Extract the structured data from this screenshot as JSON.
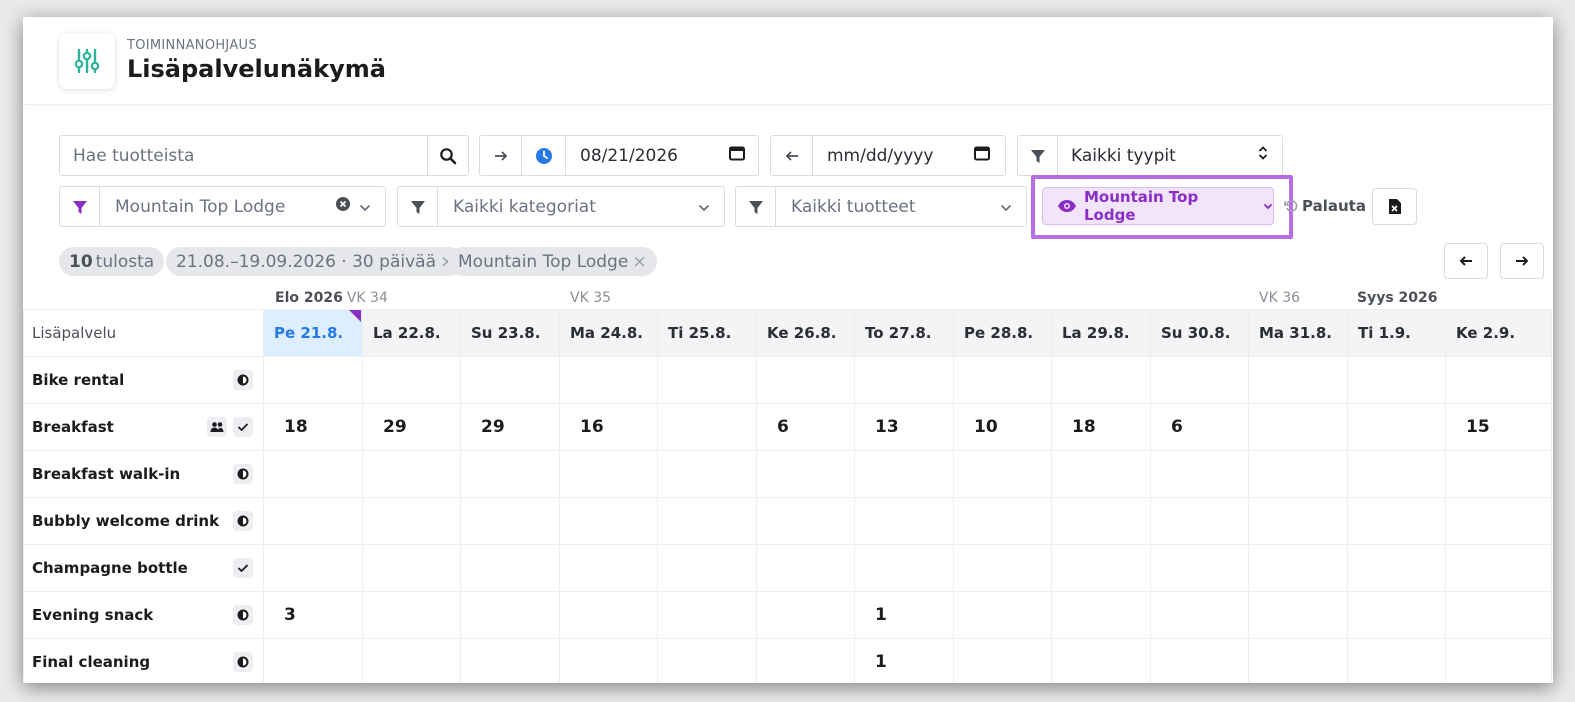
{
  "header": {
    "subtitle": "TOIMINNANOHJAUS",
    "title": "Lisäpalvelunäkymä",
    "icon": "sliders-icon"
  },
  "filters": {
    "search_placeholder": "Hae tuotteista",
    "start_date": "08/21/2026",
    "end_date_placeholder": "mm/dd/yyyy",
    "type_select": "Kaikki tyypit",
    "property_select": "Mountain Top Lodge",
    "category_select": "Kaikki kategoriat",
    "product_select": "Kaikki tuotteet",
    "view_button": "Mountain Top Lodge",
    "reset_label": "Palauta"
  },
  "summary": {
    "count": "10",
    "count_label": "tulosta",
    "date_chip": "21.08.–19.09.2026 · 30 päivää",
    "property_chip": "Mountain Top Lodge",
    "close": "×"
  },
  "weeks": [
    {
      "month": "Elo 2026",
      "week": "VK 34"
    },
    {
      "month": "",
      "week": "VK 35"
    },
    {
      "month": "",
      "week": "VK 36"
    },
    {
      "month": "Syys 2026",
      "week": ""
    }
  ],
  "table": {
    "first_header": "Lisäpalvelu",
    "days": [
      "Pe 21.8.",
      "La 22.8.",
      "Su 23.8.",
      "Ma 24.8.",
      "Ti 25.8.",
      "Ke 26.8.",
      "To 27.8.",
      "Pe 28.8.",
      "La 29.8.",
      "Su 30.8.",
      "Ma 31.8.",
      "Ti 1.9.",
      "Ke 2.9."
    ],
    "rows": [
      {
        "name": "Bike rental",
        "icons": [
          "half-circle-icon"
        ],
        "values": [
          "",
          "",
          "",
          "",
          "",
          "",
          "",
          "",
          "",
          "",
          "",
          "",
          ""
        ]
      },
      {
        "name": "Breakfast",
        "icons": [
          "people-icon",
          "check-icon"
        ],
        "values": [
          "18",
          "29",
          "29",
          "16",
          "",
          "6",
          "13",
          "10",
          "18",
          "6",
          "",
          "",
          "15"
        ]
      },
      {
        "name": "Breakfast walk-in",
        "icons": [
          "half-circle-icon"
        ],
        "values": [
          "",
          "",
          "",
          "",
          "",
          "",
          "",
          "",
          "",
          "",
          "",
          "",
          ""
        ]
      },
      {
        "name": "Bubbly welcome drink",
        "icons": [
          "half-circle-icon"
        ],
        "values": [
          "",
          "",
          "",
          "",
          "",
          "",
          "",
          "",
          "",
          "",
          "",
          "",
          ""
        ]
      },
      {
        "name": "Champagne bottle",
        "icons": [
          "check-icon"
        ],
        "values": [
          "",
          "",
          "",
          "",
          "",
          "",
          "",
          "",
          "",
          "",
          "",
          "",
          ""
        ]
      },
      {
        "name": "Evening snack",
        "icons": [
          "half-circle-icon"
        ],
        "values": [
          "3",
          "",
          "",
          "",
          "",
          "",
          "1",
          "",
          "",
          "",
          "",
          "",
          ""
        ]
      },
      {
        "name": "Final cleaning",
        "icons": [
          "half-circle-icon"
        ],
        "values": [
          "",
          "",
          "",
          "",
          "",
          "",
          "1",
          "",
          "",
          "",
          "",
          "",
          ""
        ]
      }
    ]
  },
  "colors": {
    "accent_purple": "#8a2ec4",
    "today_blue": "#2779e6",
    "icon_green": "#2bb39a"
  }
}
